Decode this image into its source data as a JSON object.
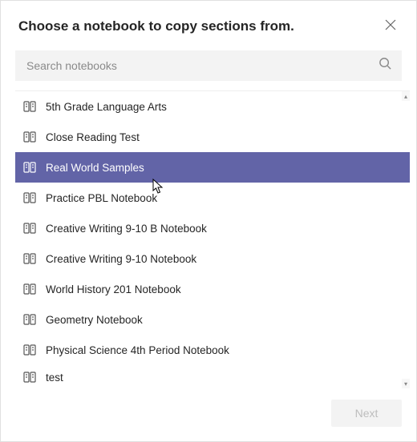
{
  "dialog": {
    "title": "Choose a notebook to copy sections from."
  },
  "search": {
    "placeholder": "Search notebooks",
    "value": ""
  },
  "notebooks": [
    {
      "label": "5th Grade Language Arts",
      "selected": false
    },
    {
      "label": "Close Reading Test",
      "selected": false
    },
    {
      "label": "Real World Samples",
      "selected": true
    },
    {
      "label": "Practice PBL Notebook",
      "selected": false
    },
    {
      "label": "Creative Writing 9-10 B Notebook",
      "selected": false
    },
    {
      "label": "Creative Writing 9-10 Notebook",
      "selected": false
    },
    {
      "label": "World History 201 Notebook",
      "selected": false
    },
    {
      "label": "Geometry Notebook",
      "selected": false
    },
    {
      "label": "Physical Science 4th Period Notebook",
      "selected": false
    },
    {
      "label": "test",
      "selected": false
    }
  ],
  "footer": {
    "next_label": "Next"
  }
}
